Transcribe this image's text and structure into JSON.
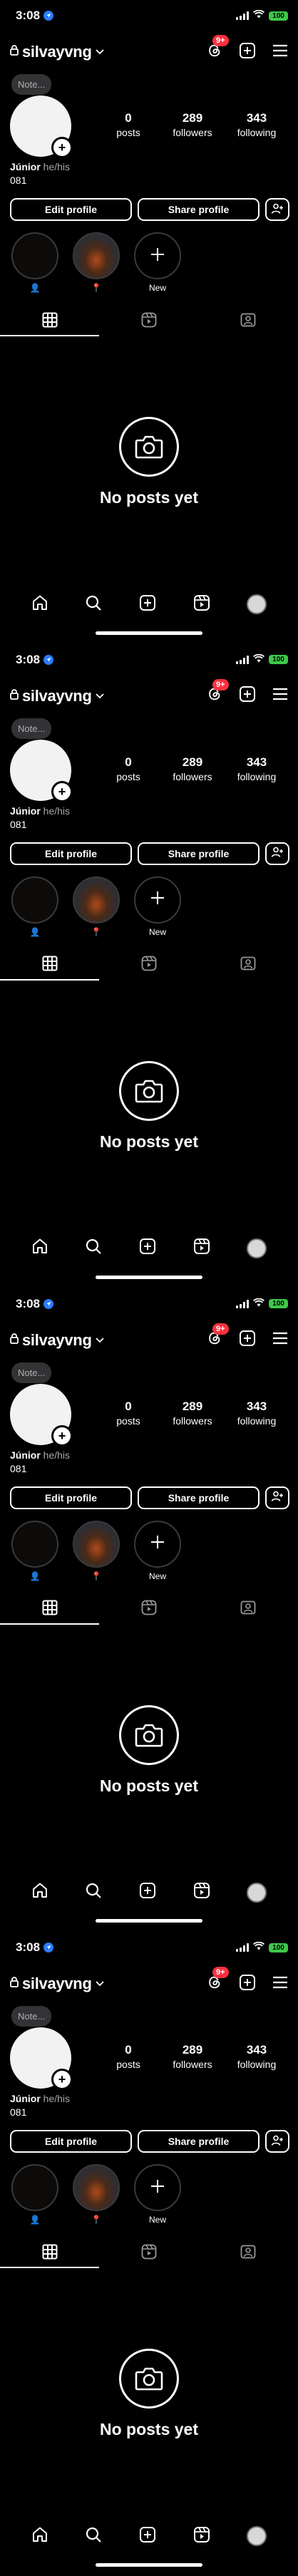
{
  "status_bar": {
    "time": "3:08",
    "battery": "100"
  },
  "header": {
    "username": "silvayvng",
    "notifications_badge": "9+"
  },
  "profile": {
    "note_placeholder": "Note...",
    "stats": [
      {
        "value": "0",
        "label": "posts"
      },
      {
        "value": "289",
        "label": "followers"
      },
      {
        "value": "343",
        "label": "following"
      }
    ],
    "name": "Júnior",
    "pronouns": "he/his",
    "bio": "081"
  },
  "buttons": {
    "edit_profile": "Edit profile",
    "share_profile": "Share profile"
  },
  "highlights": [
    {
      "label": "👤"
    },
    {
      "label": "📍"
    },
    {
      "label": "New"
    }
  ],
  "empty_state": {
    "text": "No posts yet"
  },
  "screens_count": 4
}
